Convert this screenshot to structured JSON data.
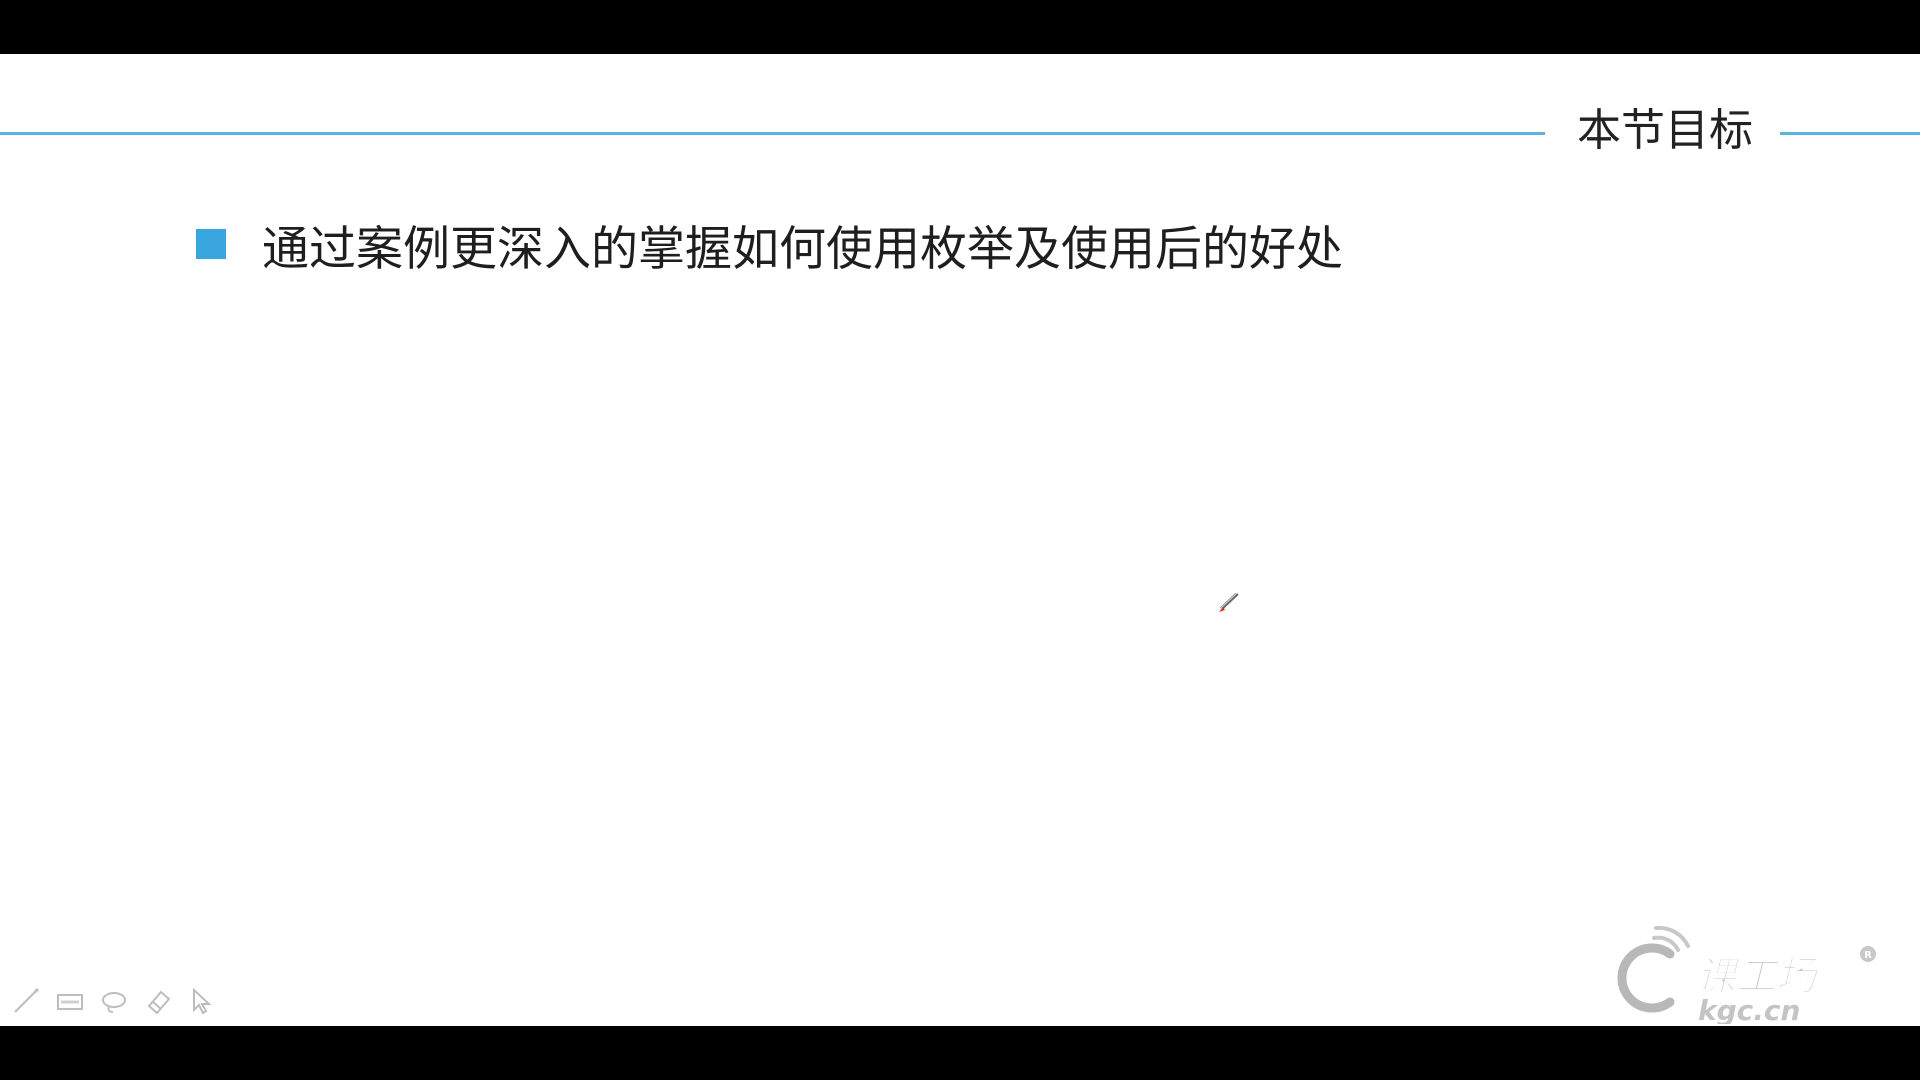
{
  "slide": {
    "section_title": "本节目标",
    "bullets": [
      {
        "text": "通过案例更深入的掌握如何使用枚举及使用后的好处"
      }
    ]
  },
  "toolbar": {
    "tools": [
      {
        "icon": "pen-icon"
      },
      {
        "icon": "highlighter-icon"
      },
      {
        "icon": "lasso-icon"
      },
      {
        "icon": "eraser-icon"
      },
      {
        "icon": "pointer-icon"
      }
    ]
  },
  "branding": {
    "logo_text": "课工场",
    "logo_sub": "kgc.cn"
  },
  "colors": {
    "accent": "#3aa6e0",
    "rule": "#5bb2dc",
    "letterbox": "#000000",
    "slide_bg": "#ffffff"
  }
}
